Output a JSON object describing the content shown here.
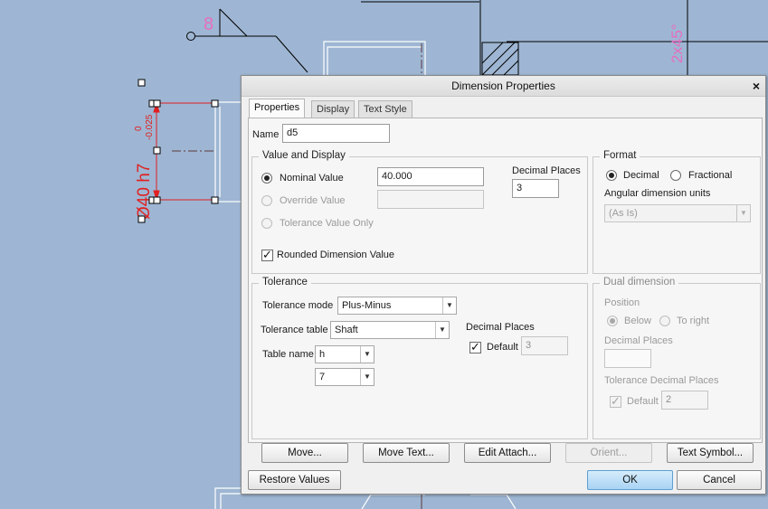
{
  "drawing": {
    "dim_label": "Ø40 h7",
    "tol_upper": "0",
    "tol_lower": "-0.025",
    "chamfer_label": "2x45°",
    "surface_label": "8"
  },
  "dialog": {
    "title": "Dimension Properties",
    "close_glyph": "×",
    "tabs": [
      "Properties",
      "Display",
      "Text Style"
    ],
    "name_label": "Name",
    "name_value": "d5",
    "value_display": {
      "title": "Value and Display",
      "nominal_label": "Nominal Value",
      "nominal_value": "40.000",
      "override_label": "Override Value",
      "override_value": "",
      "tolerance_only_label": "Tolerance Value Only",
      "decimal_places_label": "Decimal Places",
      "decimal_places_value": "3",
      "rounded_label": "Rounded Dimension Value",
      "rounded_checked": true
    },
    "format": {
      "title": "Format",
      "decimal_label": "Decimal",
      "fractional_label": "Fractional",
      "angular_label": "Angular dimension units",
      "angular_value": "(As Is)"
    },
    "tolerance": {
      "title": "Tolerance",
      "mode_label": "Tolerance mode",
      "mode_value": "Plus-Minus",
      "table_label": "Tolerance table",
      "table_value": "Shaft",
      "table_name_label": "Table name",
      "table_name_value": "h",
      "grade_value": "7",
      "decimal_places_label": "Decimal Places",
      "default_label": "Default",
      "default_value": "3"
    },
    "dual": {
      "title": "Dual dimension",
      "position_label": "Position",
      "below_label": "Below",
      "right_label": "To right",
      "decimal_places_label": "Decimal Places",
      "decimal_places_value": "",
      "tol_decimal_label": "Tolerance Decimal Places",
      "default_label": "Default",
      "default_value": "2"
    },
    "buttons": {
      "move": "Move...",
      "move_text": "Move Text...",
      "edit_attach": "Edit Attach...",
      "orient": "Orient...",
      "text_symbol": "Text Symbol...",
      "restore": "Restore Values",
      "ok": "OK",
      "cancel": "Cancel"
    },
    "colors": {
      "background": "#9eb6d3",
      "dimension_red": "#e02020",
      "annotation_pink": "#e66ec0",
      "ok_button": "#a8d3f3"
    }
  }
}
